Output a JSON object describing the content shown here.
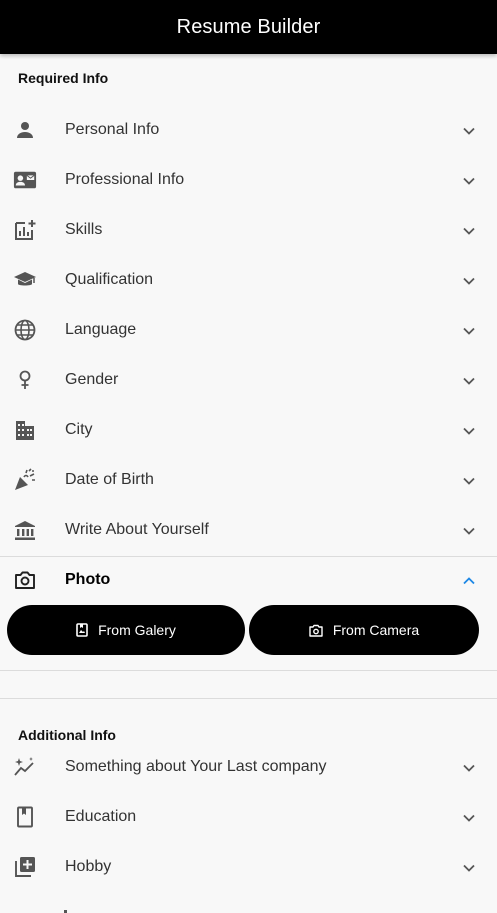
{
  "app_bar": {
    "title": "Resume Builder"
  },
  "required_section": {
    "header": "Required Info",
    "items": [
      {
        "label": "Personal Info",
        "icon": "person-icon"
      },
      {
        "label": "Professional Info",
        "icon": "contact-card-icon"
      },
      {
        "label": "Skills",
        "icon": "chart-add-icon"
      },
      {
        "label": "Qualification",
        "icon": "graduation-cap-icon"
      },
      {
        "label": "Language",
        "icon": "globe-icon"
      },
      {
        "label": "Gender",
        "icon": "female-symbol-icon"
      },
      {
        "label": "City",
        "icon": "city-icon"
      },
      {
        "label": "Date of Birth",
        "icon": "party-popper-icon"
      },
      {
        "label": "Write About Yourself",
        "icon": "bank-building-icon"
      }
    ],
    "photo": {
      "label": "Photo",
      "icon": "camera-icon",
      "expanded": true,
      "gallery_button": "From Galery",
      "camera_button": "From Camera"
    }
  },
  "additional_section": {
    "header": "Additional Info",
    "items": [
      {
        "label": "Something about Your Last company",
        "icon": "sparkle-trend-icon"
      },
      {
        "label": "Education",
        "icon": "book-icon"
      },
      {
        "label": "Hobby",
        "icon": "library-add-icon"
      }
    ]
  },
  "colors": {
    "app_bar": "#000000",
    "accent": "#1e88e5",
    "background": "#f8f8f8",
    "icon": "#555555"
  }
}
